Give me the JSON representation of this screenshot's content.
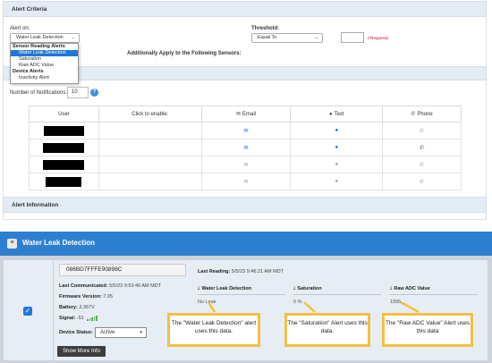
{
  "criteria": {
    "header": "Alert Criteria",
    "alert_on_label": "Alert on:",
    "alert_on_value": "Water Leak Detection",
    "threshold_label": "Threshold:",
    "threshold_value": "Equal To",
    "required_text": "(*Required)",
    "additional_sensors": "Additionally Apply to the Following Sensors:"
  },
  "dropdown": {
    "group1": "Sensor Reading Alerts",
    "opt_water_leak": "Water Leak Detection",
    "opt_saturation": "Saturation",
    "opt_raw_adc": "Raw ADC Value",
    "group2": "Device Alerts",
    "opt_inactivity": "Inactivity Alert"
  },
  "notifications": {
    "label": "Number of Notifications:",
    "value": "10",
    "help": "?"
  },
  "users_table": {
    "headers": {
      "user": "User",
      "click_enable": "Click to enable:",
      "email": "Email",
      "text": "Text",
      "phone": "Phone"
    }
  },
  "alert_info": {
    "header": "Alert Information"
  },
  "sensor_panel": {
    "title": "Water Leak Detection",
    "serial": "086BD7FFFE90898C",
    "last_reading_label": "Last Reading:",
    "last_reading_value": "5/5/23 9:46:21 AM MDT",
    "last_comm_label": "Last Communicated:",
    "last_comm_value": "5/5/23 9:53:40 AM MDT",
    "firmware_label": "Firmware Version:",
    "firmware_value": "7.05",
    "battery_label": "Battery:",
    "battery_value": "3.367V",
    "signal_label": "Signal:",
    "signal_value": "-51",
    "device_status_label": "Device Status:",
    "device_status_value": "Active",
    "show_more": "Show More Info",
    "col_water_leak": "Water Leak Detection",
    "col_saturation": "Saturation",
    "col_raw_adc": "Raw ADC Value",
    "val_water_leak": "No Leak",
    "val_saturation": "0 %",
    "val_raw_adc": "1995"
  },
  "callouts": {
    "water_leak": "The \"Water Leak Detection\" alert uses this data.",
    "saturation": "The \"Saturation\" Alert uses this data.",
    "raw_adc": "The \"Raw ADC Value\" Alert uses this data"
  },
  "colors": {
    "accent_blue": "#2f7fd0",
    "callout_border": "#f2c043",
    "required_red": "#d0021b"
  },
  "icons": {
    "email": "envelope-icon",
    "text": "chat-bubble-icon",
    "phone": "phone-icon"
  }
}
